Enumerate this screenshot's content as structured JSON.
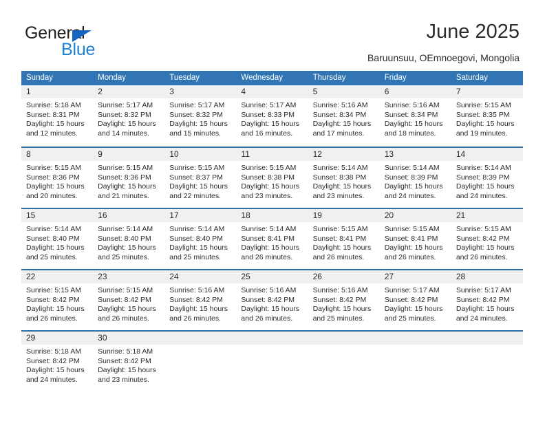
{
  "brand": {
    "word_top": "General",
    "word_bottom": "Blue",
    "triangle_color": "#1565c0",
    "blue_color": "#1f7fd4"
  },
  "header": {
    "title": "June 2025",
    "subtitle": "Baruunsuu, OEmnoegovi, Mongolia"
  },
  "theme": {
    "header_blue": "#3175b4",
    "row_divider_blue": "#2e6da8",
    "daynum_band": "#f0f0f0"
  },
  "weekday_headers": [
    "Sunday",
    "Monday",
    "Tuesday",
    "Wednesday",
    "Thursday",
    "Friday",
    "Saturday"
  ],
  "weeks": [
    [
      {
        "day": "1",
        "sunrise": "Sunrise: 5:18 AM",
        "sunset": "Sunset: 8:31 PM",
        "daylight1": "Daylight: 15 hours",
        "daylight2": "and 12 minutes."
      },
      {
        "day": "2",
        "sunrise": "Sunrise: 5:17 AM",
        "sunset": "Sunset: 8:32 PM",
        "daylight1": "Daylight: 15 hours",
        "daylight2": "and 14 minutes."
      },
      {
        "day": "3",
        "sunrise": "Sunrise: 5:17 AM",
        "sunset": "Sunset: 8:32 PM",
        "daylight1": "Daylight: 15 hours",
        "daylight2": "and 15 minutes."
      },
      {
        "day": "4",
        "sunrise": "Sunrise: 5:17 AM",
        "sunset": "Sunset: 8:33 PM",
        "daylight1": "Daylight: 15 hours",
        "daylight2": "and 16 minutes."
      },
      {
        "day": "5",
        "sunrise": "Sunrise: 5:16 AM",
        "sunset": "Sunset: 8:34 PM",
        "daylight1": "Daylight: 15 hours",
        "daylight2": "and 17 minutes."
      },
      {
        "day": "6",
        "sunrise": "Sunrise: 5:16 AM",
        "sunset": "Sunset: 8:34 PM",
        "daylight1": "Daylight: 15 hours",
        "daylight2": "and 18 minutes."
      },
      {
        "day": "7",
        "sunrise": "Sunrise: 5:15 AM",
        "sunset": "Sunset: 8:35 PM",
        "daylight1": "Daylight: 15 hours",
        "daylight2": "and 19 minutes."
      }
    ],
    [
      {
        "day": "8",
        "sunrise": "Sunrise: 5:15 AM",
        "sunset": "Sunset: 8:36 PM",
        "daylight1": "Daylight: 15 hours",
        "daylight2": "and 20 minutes."
      },
      {
        "day": "9",
        "sunrise": "Sunrise: 5:15 AM",
        "sunset": "Sunset: 8:36 PM",
        "daylight1": "Daylight: 15 hours",
        "daylight2": "and 21 minutes."
      },
      {
        "day": "10",
        "sunrise": "Sunrise: 5:15 AM",
        "sunset": "Sunset: 8:37 PM",
        "daylight1": "Daylight: 15 hours",
        "daylight2": "and 22 minutes."
      },
      {
        "day": "11",
        "sunrise": "Sunrise: 5:15 AM",
        "sunset": "Sunset: 8:38 PM",
        "daylight1": "Daylight: 15 hours",
        "daylight2": "and 23 minutes."
      },
      {
        "day": "12",
        "sunrise": "Sunrise: 5:14 AM",
        "sunset": "Sunset: 8:38 PM",
        "daylight1": "Daylight: 15 hours",
        "daylight2": "and 23 minutes."
      },
      {
        "day": "13",
        "sunrise": "Sunrise: 5:14 AM",
        "sunset": "Sunset: 8:39 PM",
        "daylight1": "Daylight: 15 hours",
        "daylight2": "and 24 minutes."
      },
      {
        "day": "14",
        "sunrise": "Sunrise: 5:14 AM",
        "sunset": "Sunset: 8:39 PM",
        "daylight1": "Daylight: 15 hours",
        "daylight2": "and 24 minutes."
      }
    ],
    [
      {
        "day": "15",
        "sunrise": "Sunrise: 5:14 AM",
        "sunset": "Sunset: 8:40 PM",
        "daylight1": "Daylight: 15 hours",
        "daylight2": "and 25 minutes."
      },
      {
        "day": "16",
        "sunrise": "Sunrise: 5:14 AM",
        "sunset": "Sunset: 8:40 PM",
        "daylight1": "Daylight: 15 hours",
        "daylight2": "and 25 minutes."
      },
      {
        "day": "17",
        "sunrise": "Sunrise: 5:14 AM",
        "sunset": "Sunset: 8:40 PM",
        "daylight1": "Daylight: 15 hours",
        "daylight2": "and 25 minutes."
      },
      {
        "day": "18",
        "sunrise": "Sunrise: 5:14 AM",
        "sunset": "Sunset: 8:41 PM",
        "daylight1": "Daylight: 15 hours",
        "daylight2": "and 26 minutes."
      },
      {
        "day": "19",
        "sunrise": "Sunrise: 5:15 AM",
        "sunset": "Sunset: 8:41 PM",
        "daylight1": "Daylight: 15 hours",
        "daylight2": "and 26 minutes."
      },
      {
        "day": "20",
        "sunrise": "Sunrise: 5:15 AM",
        "sunset": "Sunset: 8:41 PM",
        "daylight1": "Daylight: 15 hours",
        "daylight2": "and 26 minutes."
      },
      {
        "day": "21",
        "sunrise": "Sunrise: 5:15 AM",
        "sunset": "Sunset: 8:42 PM",
        "daylight1": "Daylight: 15 hours",
        "daylight2": "and 26 minutes."
      }
    ],
    [
      {
        "day": "22",
        "sunrise": "Sunrise: 5:15 AM",
        "sunset": "Sunset: 8:42 PM",
        "daylight1": "Daylight: 15 hours",
        "daylight2": "and 26 minutes."
      },
      {
        "day": "23",
        "sunrise": "Sunrise: 5:15 AM",
        "sunset": "Sunset: 8:42 PM",
        "daylight1": "Daylight: 15 hours",
        "daylight2": "and 26 minutes."
      },
      {
        "day": "24",
        "sunrise": "Sunrise: 5:16 AM",
        "sunset": "Sunset: 8:42 PM",
        "daylight1": "Daylight: 15 hours",
        "daylight2": "and 26 minutes."
      },
      {
        "day": "25",
        "sunrise": "Sunrise: 5:16 AM",
        "sunset": "Sunset: 8:42 PM",
        "daylight1": "Daylight: 15 hours",
        "daylight2": "and 26 minutes."
      },
      {
        "day": "26",
        "sunrise": "Sunrise: 5:16 AM",
        "sunset": "Sunset: 8:42 PM",
        "daylight1": "Daylight: 15 hours",
        "daylight2": "and 25 minutes."
      },
      {
        "day": "27",
        "sunrise": "Sunrise: 5:17 AM",
        "sunset": "Sunset: 8:42 PM",
        "daylight1": "Daylight: 15 hours",
        "daylight2": "and 25 minutes."
      },
      {
        "day": "28",
        "sunrise": "Sunrise: 5:17 AM",
        "sunset": "Sunset: 8:42 PM",
        "daylight1": "Daylight: 15 hours",
        "daylight2": "and 24 minutes."
      }
    ],
    [
      {
        "day": "29",
        "sunrise": "Sunrise: 5:18 AM",
        "sunset": "Sunset: 8:42 PM",
        "daylight1": "Daylight: 15 hours",
        "daylight2": "and 24 minutes."
      },
      {
        "day": "30",
        "sunrise": "Sunrise: 5:18 AM",
        "sunset": "Sunset: 8:42 PM",
        "daylight1": "Daylight: 15 hours",
        "daylight2": "and 23 minutes."
      },
      {
        "day": "",
        "sunrise": "",
        "sunset": "",
        "daylight1": "",
        "daylight2": ""
      },
      {
        "day": "",
        "sunrise": "",
        "sunset": "",
        "daylight1": "",
        "daylight2": ""
      },
      {
        "day": "",
        "sunrise": "",
        "sunset": "",
        "daylight1": "",
        "daylight2": ""
      },
      {
        "day": "",
        "sunrise": "",
        "sunset": "",
        "daylight1": "",
        "daylight2": ""
      },
      {
        "day": "",
        "sunrise": "",
        "sunset": "",
        "daylight1": "",
        "daylight2": ""
      }
    ]
  ]
}
